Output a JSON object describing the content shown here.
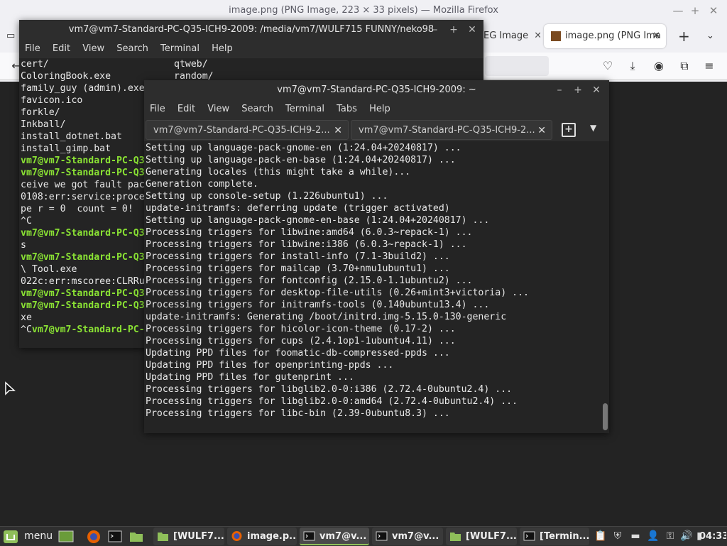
{
  "firefox": {
    "window_title": "image.png (PNG Image, 223 × 33 pixels) — Mozilla Firefox",
    "tab_inactive": "EG Image",
    "tab_active": "image.png (PNG Ima"
  },
  "terminal_back": {
    "title": "vm7@vm7-Standard-PC-Q35-ICH9-2009: /media/vm7/WULF715 FUNNY/neko98",
    "menu": [
      "File",
      "Edit",
      "View",
      "Search",
      "Terminal",
      "Help"
    ],
    "lines": [
      {
        "text": "cert/",
        "green": false
      },
      {
        "text": "ColoringBook.exe",
        "green": false
      },
      {
        "text": "family_guy (admin).exe",
        "green": false
      },
      {
        "text": "favicon.ico",
        "green": false
      },
      {
        "text": "forkle/",
        "green": false
      },
      {
        "text": "Inkball/",
        "green": false
      },
      {
        "text": "install_dotnet.bat",
        "green": false
      },
      {
        "text": "install_gimp.bat",
        "green": false
      },
      {
        "text": "vm7@vm7-Standard-PC-Q3",
        "green": true
      },
      {
        "text": "vm7@vm7-Standard-PC-Q3",
        "green": true
      },
      {
        "text": "ceive we got fault pac",
        "green": false
      },
      {
        "text": "0108:err:service:proce",
        "green": false
      },
      {
        "text": "pe r = 0  count = 0!",
        "green": false
      },
      {
        "text": "^C",
        "green": false
      },
      {
        "text": "vm7@vm7-Standard-PC-Q3",
        "green": true
      },
      {
        "text": "s",
        "green": false
      },
      {
        "text": "vm7@vm7-Standard-PC-Q3",
        "green": true
      },
      {
        "text": "\\ Tool.exe",
        "green": false
      },
      {
        "text": "022c:err:mscoree:CLRRu",
        "green": false
      },
      {
        "text": "vm7@vm7-Standard-PC-Q3",
        "green": true
      },
      {
        "text": "vm7@vm7-Standard-PC-Q3",
        "green": true
      },
      {
        "text": "xe",
        "green": false
      }
    ],
    "last_line_prefix": "^C",
    "last_line_green": "vm7@vm7-Standard-PC-",
    "right_col": [
      "qtweb/",
      "random/"
    ]
  },
  "terminal_front": {
    "title": "vm7@vm7-Standard-PC-Q35-ICH9-2009: ~",
    "menu": [
      "File",
      "Edit",
      "View",
      "Search",
      "Terminal",
      "Tabs",
      "Help"
    ],
    "tabs": [
      "vm7@vm7-Standard-PC-Q35-ICH9-2...",
      "vm7@vm7-Standard-PC-Q35-ICH9-2..."
    ],
    "lines": [
      "Setting up language-pack-gnome-en (1:24.04+20240817) ...",
      "Setting up language-pack-en-base (1:24.04+20240817) ...",
      "Generating locales (this might take a while)...",
      "Generation complete.",
      "Setting up console-setup (1.226ubuntu1) ...",
      "update-initramfs: deferring update (trigger activated)",
      "Setting up language-pack-gnome-en-base (1:24.04+20240817) ...",
      "Processing triggers for libwine:amd64 (6.0.3~repack-1) ...",
      "Processing triggers for libwine:i386 (6.0.3~repack-1) ...",
      "Processing triggers for install-info (7.1-3build2) ...",
      "Processing triggers for mailcap (3.70+nmu1ubuntu1) ...",
      "Processing triggers for fontconfig (2.15.0-1.1ubuntu2) ...",
      "Processing triggers for desktop-file-utils (0.26+mint3+victoria) ...",
      "Processing triggers for initramfs-tools (0.140ubuntu13.4) ...",
      "update-initramfs: Generating /boot/initrd.img-5.15.0-130-generic",
      "Processing triggers for hicolor-icon-theme (0.17-2) ...",
      "Processing triggers for cups (2.4.1op1-1ubuntu4.11) ...",
      "Updating PPD files for foomatic-db-compressed-ppds ...",
      "Updating PPD files for openprinting-ppds ...",
      "Updating PPD files for gutenprint ...",
      "Processing triggers for libglib2.0-0:i386 (2.72.4-0ubuntu2.4) ...",
      "Processing triggers for libglib2.0-0:amd64 (2.72.4-0ubuntu2.4) ...",
      "Processing triggers for libc-bin (2.39-0ubuntu8.3) ..."
    ]
  },
  "taskbar": {
    "menu_label": "menu",
    "items": [
      "[WULF7...",
      "image.p...",
      "vm7@v...",
      "vm7@v...",
      "[WULF7...",
      "[Termin..."
    ],
    "clock": "04:33"
  },
  "colors": {
    "prompt_green": "#8ae234",
    "terminal_bg": "#242424",
    "active_task": "#8fbf5a"
  }
}
